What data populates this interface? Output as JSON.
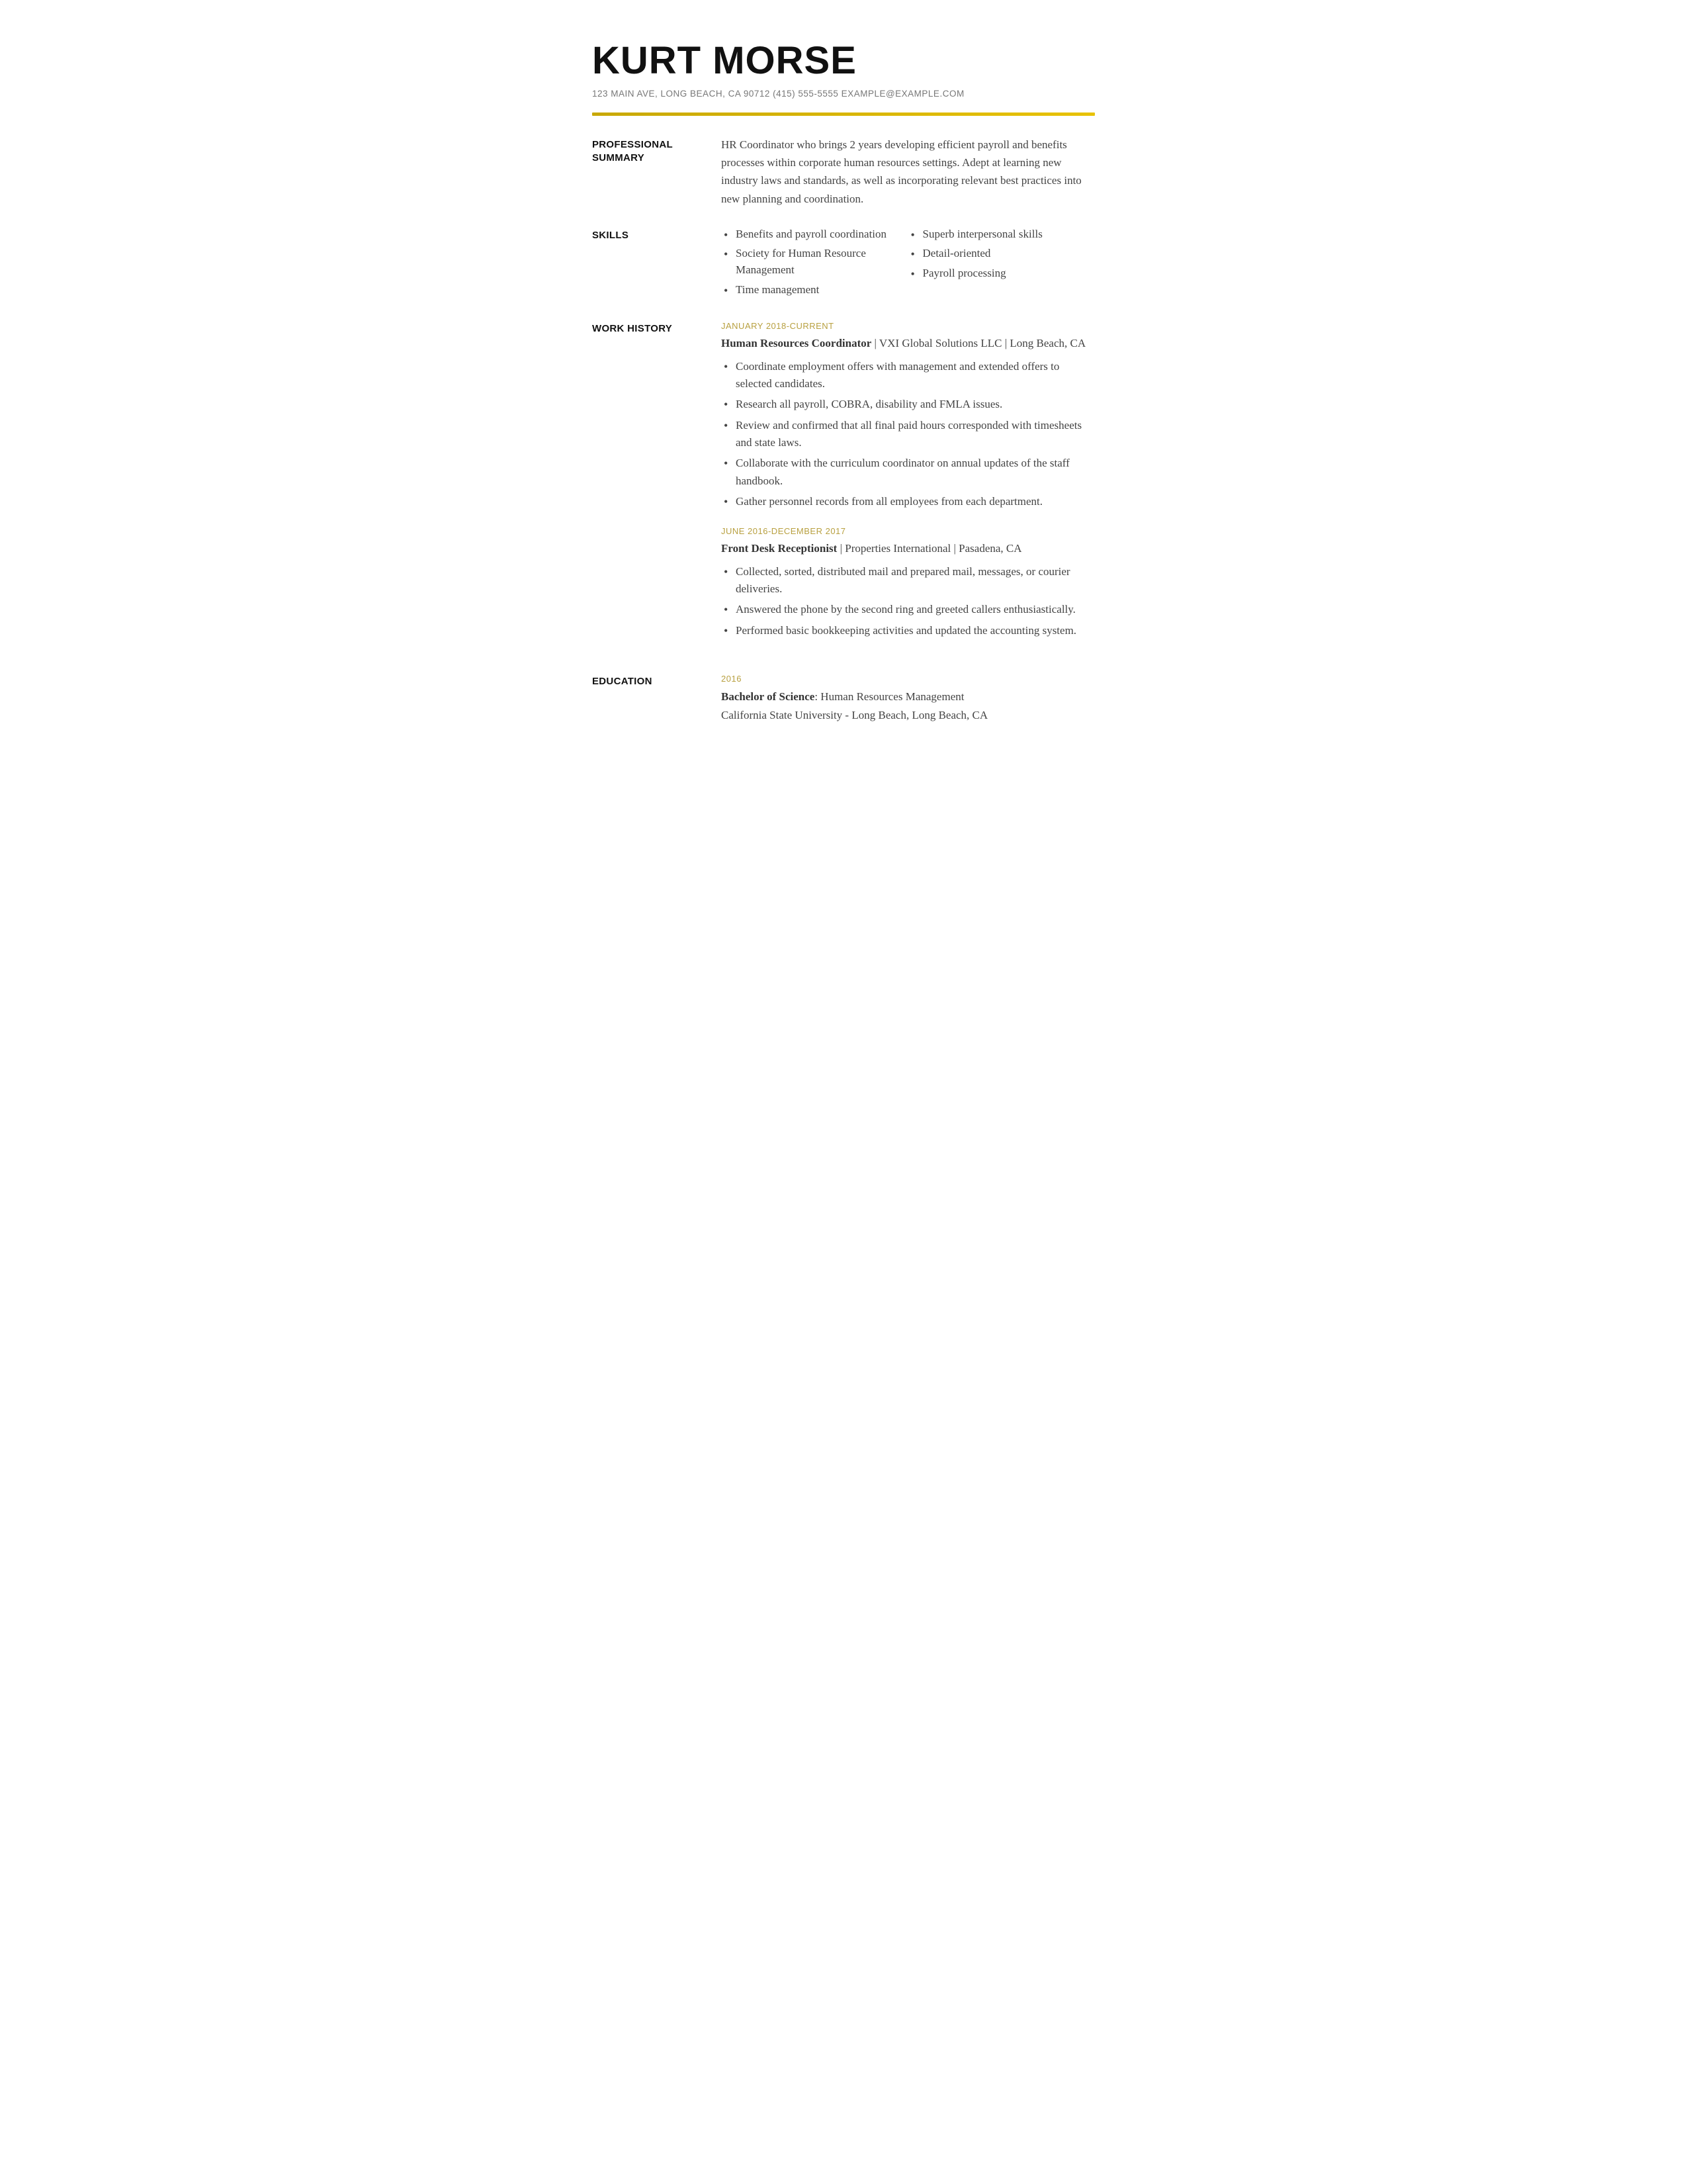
{
  "header": {
    "name": "KURT MORSE",
    "contact": "123 MAIN AVE, LONG BEACH, CA 90712 (415) 555-5555 EXAMPLE@EXAMPLE.COM"
  },
  "sections": {
    "summary": {
      "label": "PROFESSIONAL SUMMARY",
      "text": "HR Coordinator who brings 2 years developing efficient payroll and benefits processes within corporate human resources settings. Adept at learning new industry laws and standards, as well as incorporating relevant best practices into new planning and coordination."
    },
    "skills": {
      "label": "SKILLS",
      "col1": [
        "Benefits and payroll coordination",
        "Society for Human Resource Management",
        "Time management"
      ],
      "col2": [
        "Superb interpersonal skills",
        "Detail-oriented",
        "Payroll processing"
      ]
    },
    "work_history": {
      "label": "WORK HISTORY",
      "jobs": [
        {
          "date": "JANUARY 2018-CURRENT",
          "title": "Human Resources Coordinator",
          "company": "VXI Global Solutions LLC | Long Beach, CA",
          "bullets": [
            "Coordinate employment offers with management and extended offers to selected candidates.",
            "Research all payroll, COBRA, disability and FMLA issues.",
            "Review and confirmed that all final paid hours corresponded with timesheets and state laws.",
            "Collaborate with the curriculum coordinator on annual updates of the staff handbook.",
            "Gather personnel records from all employees from each department."
          ]
        },
        {
          "date": "JUNE 2016-DECEMBER 2017",
          "title": "Front Desk Receptionist",
          "company": "Properties International | Pasadena, CA",
          "bullets": [
            "Collected, sorted, distributed mail and prepared mail, messages, or courier deliveries.",
            "Answered the phone by the second ring and greeted callers enthusiastically.",
            "Performed basic bookkeeping activities and updated the accounting system."
          ]
        }
      ]
    },
    "education": {
      "label": "EDUCATION",
      "year": "2016",
      "degree": "Bachelor of Science",
      "field": ": Human Resources Management",
      "school": "California State University - Long Beach, Long Beach, CA"
    }
  }
}
